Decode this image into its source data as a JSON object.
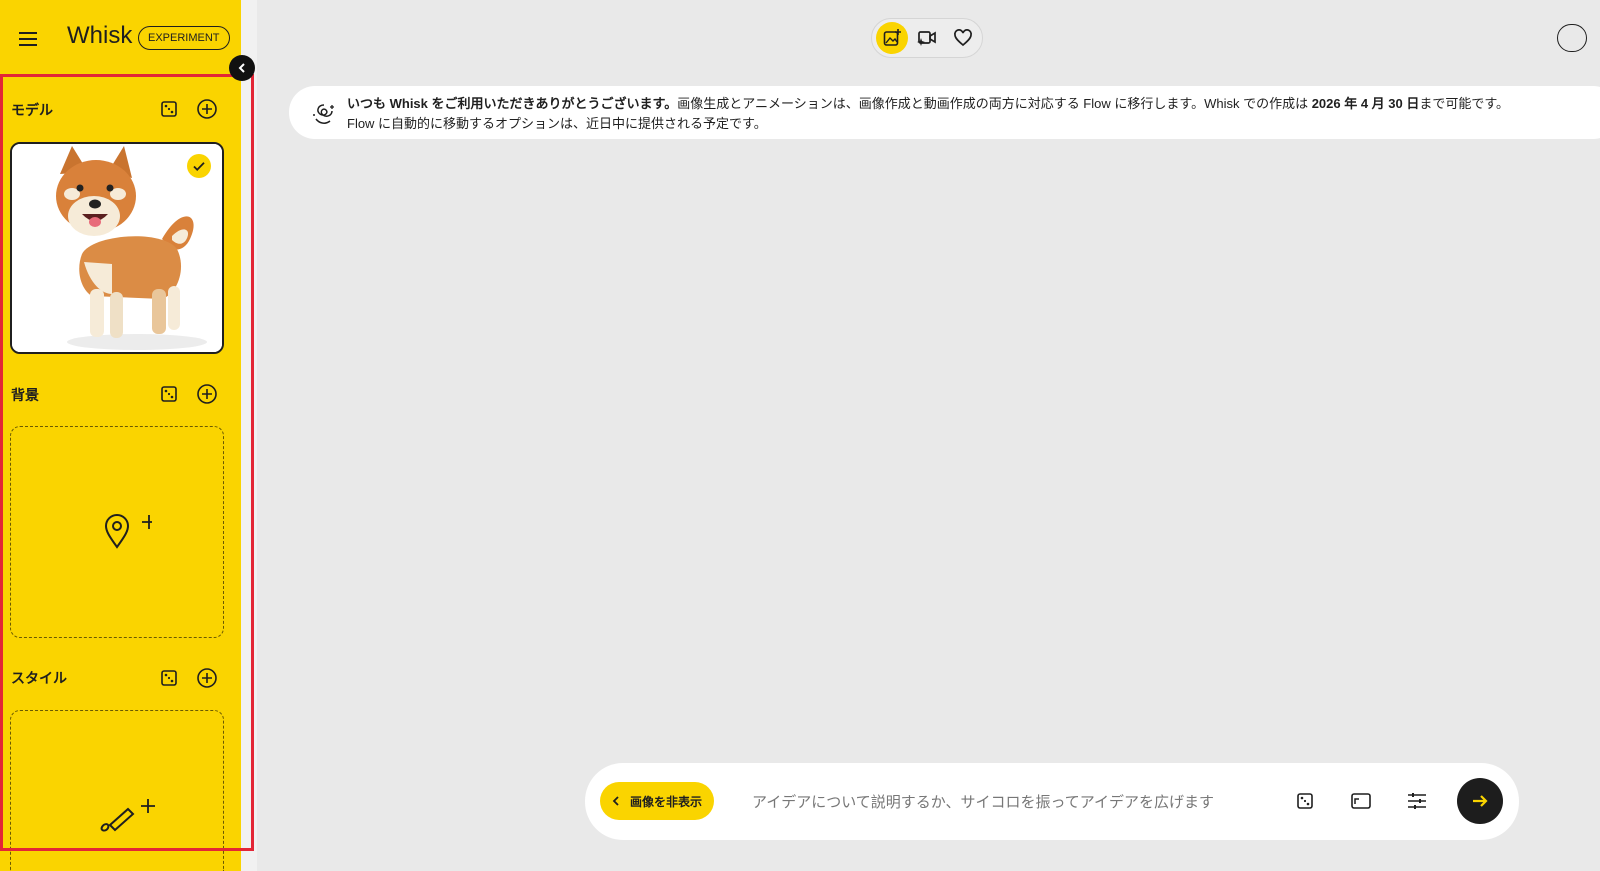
{
  "header": {
    "brand": "Whisk",
    "badge": "EXPERIMENT"
  },
  "icons": {
    "menu": "hamburger-menu-icon",
    "collapse": "chevron-left-icon",
    "random": "dice-icon",
    "add": "add-circle-icon",
    "check": "check-icon",
    "location": "location-pin-icon",
    "brush": "brush-icon",
    "image_mode": "image-add-icon",
    "video_mode": "video-sparkle-icon",
    "favorites": "heart-icon",
    "notice": "swirl-icon",
    "aspect": "aspect-ratio-icon",
    "settings": "tune-icon",
    "send": "arrow-right-icon"
  },
  "sidebar": {
    "sections": [
      {
        "title": "モデル",
        "state": "image-selected",
        "image_alt": "shiba-inu-dog"
      },
      {
        "title": "背景",
        "state": "empty"
      },
      {
        "title": "スタイル",
        "state": "empty"
      }
    ]
  },
  "notice": {
    "bold_1": "いつも Whisk をご利用いただきありがとうございます。",
    "text_1": "画像生成とアニメーションは、画像作成と動画作成の両方に対応する Flow に移行します。Whisk での作成は ",
    "bold_2": "2026 年 4 月 30 日",
    "text_2": "まで可能です。",
    "line_2": "Flow に自動的に移動するオプションは、近日中に提供される予定です。"
  },
  "prompt": {
    "hide_images_label": "画像を非表示",
    "placeholder": "アイデアについて説明するか、サイコロを振ってアイデアを広げます",
    "value": ""
  },
  "colors": {
    "accent": "#fad400",
    "background": "#e9e9e9",
    "highlight_frame": "#e32636",
    "dark": "#1d1d1d"
  }
}
